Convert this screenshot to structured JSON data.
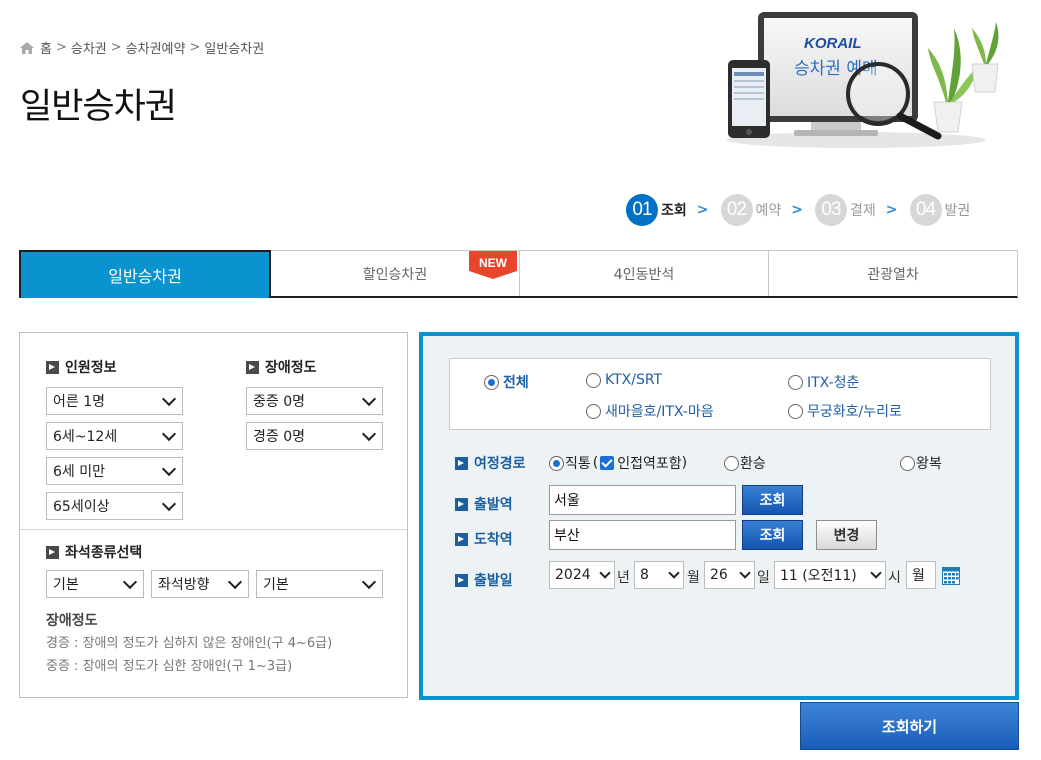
{
  "breadcrumb": {
    "items": [
      "홈",
      "승차권",
      "승차권예약",
      "일반승차권"
    ]
  },
  "page_title": "일반승차권",
  "hero": {
    "brand": "KORAIL",
    "subtitle": "승차권 예매"
  },
  "steps": [
    {
      "num": "01",
      "label": "조회",
      "active": true
    },
    {
      "num": "02",
      "label": "예약",
      "active": false
    },
    {
      "num": "03",
      "label": "결제",
      "active": false
    },
    {
      "num": "04",
      "label": "발권",
      "active": false
    }
  ],
  "tabs": [
    {
      "label": "일반승차권",
      "active": true
    },
    {
      "label": "할인승차권",
      "badge": "NEW"
    },
    {
      "label": "4인동반석"
    },
    {
      "label": "관광열차"
    }
  ],
  "passenger": {
    "title": "인원정보",
    "adult": "어른 1명",
    "child": "6세~12세",
    "infant": "6세 미만",
    "senior": "65세이상"
  },
  "disability": {
    "title": "장애정도",
    "severe": "중증 0명",
    "mild": "경증 0명"
  },
  "seat": {
    "title": "좌석종류선택",
    "type": "기본",
    "direction": "좌석방향",
    "option": "기본"
  },
  "notes": {
    "title": "장애정도",
    "mild": "경증 : 장애의 정도가 심하지 않은 장애인(구 4~6급)",
    "severe": "중증 : 장애의 정도가 심한 장애인(구 1~3급)"
  },
  "train_types": {
    "all": "전체",
    "ktx_srt": "KTX/SRT",
    "itx_cheongchun": "ITX-청춘",
    "saemaeul": "새마을호/ITX-마음",
    "mugunghwa": "무궁화호/누리로"
  },
  "route": {
    "label": "여정경로",
    "direct": "직통",
    "include_nearby": "인접역포함",
    "transfer": "환승",
    "round_trip": "왕복"
  },
  "departure": {
    "label": "출발역",
    "value": "서울",
    "search": "조회"
  },
  "arrival": {
    "label": "도착역",
    "value": "부산",
    "search": "조회",
    "swap": "변경"
  },
  "date": {
    "label": "출발일",
    "year": "2024",
    "year_unit": "년",
    "month": "8",
    "month_unit": "월",
    "day": "26",
    "day_unit": "일",
    "hour": "11 (오전11)",
    "hour_unit": "시",
    "weekday": "월"
  },
  "search_button": "조회하기"
}
